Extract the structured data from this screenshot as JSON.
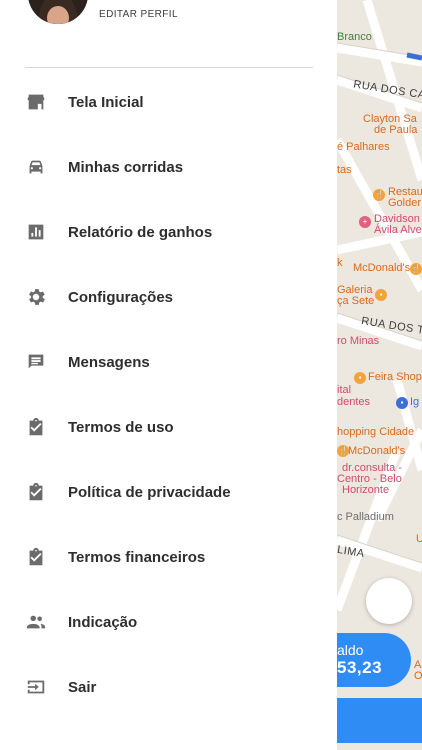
{
  "profile": {
    "edit_label": "EDITAR PERFIL"
  },
  "menu": {
    "items": [
      {
        "label": "Tela Inicial",
        "icon": "store-icon"
      },
      {
        "label": "Minhas corridas",
        "icon": "car-icon"
      },
      {
        "label": "Relatório de ganhos",
        "icon": "bar-chart-icon"
      },
      {
        "label": "Configurações",
        "icon": "gear-icon"
      },
      {
        "label": "Mensagens",
        "icon": "message-icon"
      },
      {
        "label": "Termos de uso",
        "icon": "clipboard-check-icon"
      },
      {
        "label": "Política de privacidade",
        "icon": "clipboard-check-icon"
      },
      {
        "label": "Termos financeiros",
        "icon": "clipboard-check-icon"
      },
      {
        "label": "Indicação",
        "icon": "people-icon"
      },
      {
        "label": "Sair",
        "icon": "logout-icon"
      }
    ]
  },
  "map": {
    "labels": {
      "branco": "Branco",
      "rua_dos_ca": "RUA DOS CA",
      "clayton_1": "Clayton Sa",
      "clayton_2": "de Paula",
      "palhares": "é Palhares",
      "tas": "tas",
      "restau_1": "Restau",
      "restau_2": "Golder",
      "davidson_1": "Davidson",
      "davidson_2": "Ávila Alve",
      "k": "k",
      "mcdonalds_1": "McDonald's",
      "galeria_1": "Galeria",
      "galeria_2": "ça Sete",
      "rua_dos_t": "RUA DOS T",
      "minas": "ro Minas",
      "feira": "Feira Shop",
      "ital": "ital",
      "dentes": "dentes",
      "ig": "Ig",
      "shopping": "hopping Cidade",
      "mcdonalds_2": "McDonald's",
      "drconsulta_1": "dr.consulta -",
      "drconsulta_2": "Centro - Belo",
      "drconsulta_3": "Horizonte",
      "palladium": "c Palladium",
      "lima": "LIMA",
      "u": "U",
      "a": "A",
      "o": "O"
    }
  },
  "balance": {
    "label": "aldo",
    "value": "53,23"
  },
  "colors": {
    "accent_blue": "#2f8cf5",
    "icon_gray": "#6b6b6b",
    "text_dark": "#2e2e2e",
    "map_bg": "#ece7df",
    "poi_orange": "#f2a33a",
    "poi_pink": "#e0607e"
  }
}
